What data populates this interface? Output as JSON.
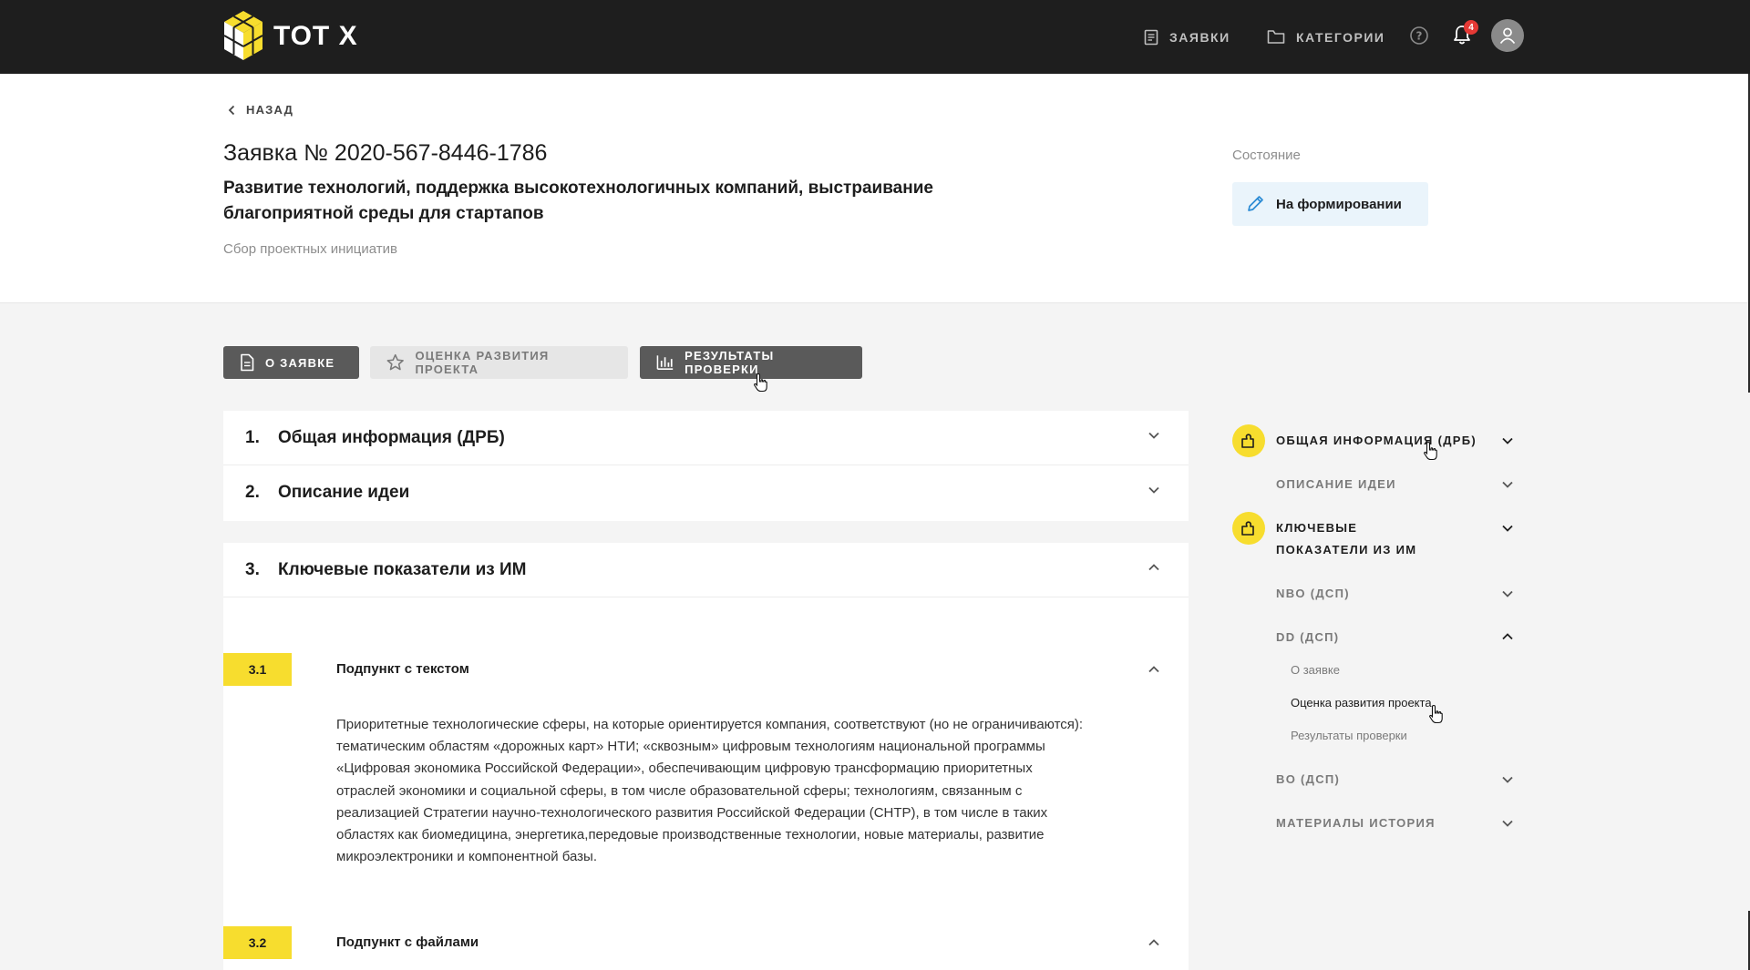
{
  "header": {
    "logo_text": "ТОТ X",
    "nav_requests": "ЗАЯВКИ",
    "nav_categories": "КАТЕГОРИИ",
    "notifications_count": "4"
  },
  "hero": {
    "back_label": "НАЗАД",
    "title": "Заявка № 2020-567-8446-1786",
    "subtitle": "Развитие технологий, поддержка высокотехнологичных компаний, выстраивание благоприятной среды для стартапов",
    "category": "Сбор проектных инициатив",
    "state_label": "Состояние",
    "state_value": "На формировании"
  },
  "tabs": {
    "about": "О ЗАЯВКЕ",
    "evaluation": "ОЦЕНКА РАЗВИТИЯ ПРОЕКТА",
    "results": "РЕЗУЛЬТАТЫ ПРОВЕРКИ"
  },
  "sections": [
    {
      "num": "1.",
      "title": "Общая информация (ДРБ)"
    },
    {
      "num": "2.",
      "title": "Описание идеи"
    },
    {
      "num": "3.",
      "title": "Ключевые показатели из ИМ"
    }
  ],
  "subsections": [
    {
      "num": "3.1",
      "title": "Подпункт с текстом",
      "text": "Приоритетные технологические сферы, на которые ориентируется компания, соответствуют (но не ограничиваются): тематическим областям «дорожных карт» НТИ; «сквозным» цифровым технологиям национальной программы «Цифровая экономика Российской Федерации», обеспечивающим цифровую трансформацию приоритетных отраслей экономики и социальной сферы, в том числе образовательной сферы; технологиям, связанным с реализацией Стратегии научно-технологического развития Российской Федерации (СНТР), в том числе в таких областях как биомедицина, энергетика,передовые производственные технологии, новые материалы, развитие микроэлектроники и компонентной базы."
    },
    {
      "num": "3.2",
      "title": "Подпункт с файлами"
    }
  ],
  "right_nav": {
    "general": "ОБЩАЯ ИНФОРМАЦИЯ (ДРБ)",
    "idea": "ОПИСАНИЕ ИДЕИ",
    "key_line1": "КЛЮЧЕВЫЕ",
    "key_line2": "ПОКАЗАТЕЛИ ИЗ ИМ",
    "nbo": "NBO (ДСП)",
    "dd": "DD (ДСП)",
    "dd_items": [
      "О заявке",
      "Оценка развития проекта",
      "Результаты проверки"
    ],
    "bo": "BO (ДСП)",
    "materials": "МАТЕРИАЛЫ ИСТОРИЯ"
  }
}
